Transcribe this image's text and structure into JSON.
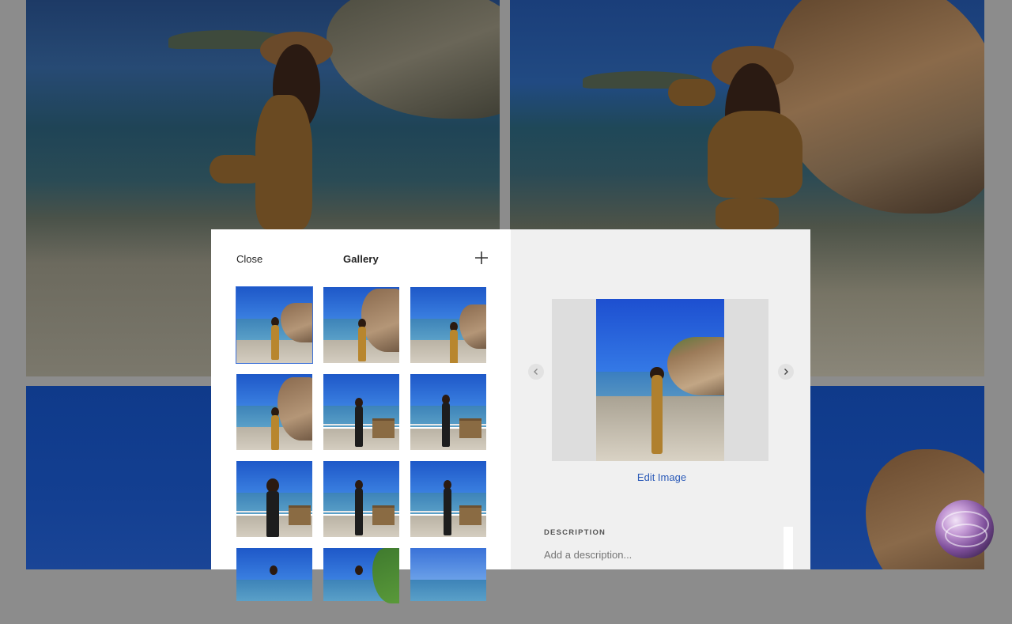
{
  "dialog": {
    "close_label": "Close",
    "title": "Gallery",
    "add_icon": "plus-icon",
    "edit_image_label": "Edit Image",
    "description_label": "DESCRIPTION",
    "description_placeholder": "Add a description...",
    "prev_icon": "chevron-left-icon",
    "next_icon": "chevron-right-icon",
    "selected_index": 0,
    "thumbnail_count": 12
  },
  "colors": {
    "accent": "#3a6fd8",
    "link": "#2c5bb8",
    "panel_left": "#ffffff",
    "panel_right": "#f0f0f0"
  }
}
